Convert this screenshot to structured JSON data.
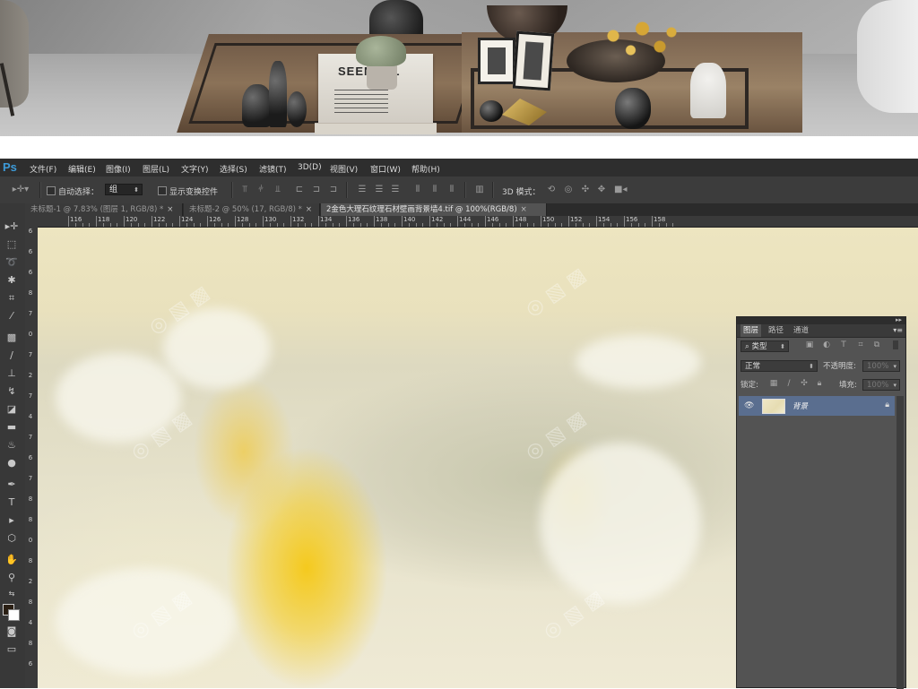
{
  "banner": {
    "book_title": "SEEN MIL"
  },
  "app": {
    "logo": "Ps",
    "menus": [
      "文件(F)",
      "编辑(E)",
      "图像(I)",
      "图层(L)",
      "文字(Y)",
      "选择(S)",
      "滤镜(T)",
      "3D(D)",
      "视图(V)",
      "窗口(W)",
      "帮助(H)"
    ]
  },
  "options": {
    "move_tool_icon": "move-tool-icon",
    "auto_select_label": "自动选择：",
    "auto_select_value": "组",
    "show_transform_label": "显示变换控件",
    "mode_3d_label": "3D 模式："
  },
  "tabs": [
    {
      "label": "未标题-1 @ 7.83% (图层 1, RGB/8) *",
      "close": "×"
    },
    {
      "label": "未标题-2 @ 50% (17, RGB/8) *",
      "close": "×"
    },
    {
      "label": "2金色大理石纹理石材壁画背景墙4.tif @ 100%(RGB/8)",
      "close": "×"
    }
  ],
  "ruler_h": [
    "116",
    "118",
    "120",
    "122",
    "124",
    "126",
    "128",
    "130",
    "132",
    "134",
    "136",
    "138",
    "140",
    "142",
    "144",
    "146",
    "148",
    "150",
    "152",
    "154",
    "156",
    "158"
  ],
  "ruler_v": [
    "6",
    "6",
    "6",
    "8",
    "7",
    "0",
    "7",
    "2",
    "7",
    "4",
    "7",
    "6",
    "7",
    "8",
    "8",
    "0",
    "8",
    "2",
    "8",
    "4",
    "8",
    "6"
  ],
  "layers_panel": {
    "collapse_glyph": "▸▸",
    "tabs": [
      "图层",
      "路径",
      "通道"
    ],
    "menu_glyph": "▾≡",
    "filter_label": "⌕ 类型",
    "blend_mode": "正常",
    "opacity_label": "不透明度:",
    "opacity_value": "100%",
    "lock_label": "锁定:",
    "fill_label": "填充:",
    "fill_value": "100%",
    "layers": [
      {
        "name": "背景",
        "visible": true,
        "locked": true
      }
    ]
  }
}
